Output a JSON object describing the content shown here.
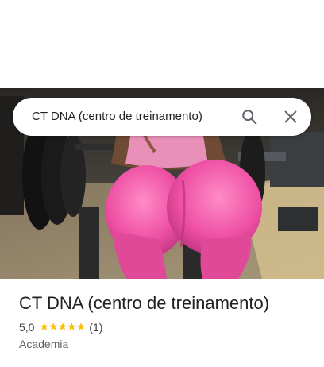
{
  "search": {
    "query": "CT DNA (centro de treinamento)",
    "search_icon": "search-icon",
    "close_icon": "close-icon"
  },
  "hero": {
    "alt": "place-photo"
  },
  "place": {
    "name": "CT DNA (centro de treinamento)",
    "rating": "5,0",
    "stars": 5,
    "reviews": "(1)",
    "category": "Academia"
  },
  "colors": {
    "star": "#fbbc04",
    "title": "#202124",
    "secondary": "#5f6368"
  }
}
